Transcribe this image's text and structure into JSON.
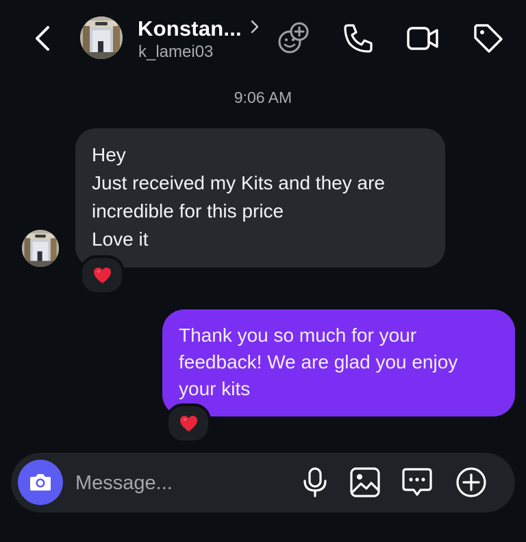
{
  "header": {
    "contact_name": "Konstan...",
    "contact_handle": "k_lamei03"
  },
  "icons": {
    "back": "chevron-left-icon",
    "profile_chevron": "chevron-right-icon",
    "add_to_group": "add-people-icon",
    "audio_call": "phone-icon",
    "video_call": "video-camera-icon",
    "label": "tag-icon",
    "camera": "camera-icon",
    "microphone": "microphone-icon",
    "gallery": "image-icon",
    "sticker": "chat-bubble-icon",
    "more": "plus-circle-icon",
    "reaction": "red-heart-emoji"
  },
  "conversation": {
    "timestamp": "9:06 AM",
    "messages": [
      {
        "direction": "incoming",
        "lines": [
          "Hey",
          "Just received my Kits and they are",
          "incredible for this price",
          "Love it"
        ],
        "reaction": "❤️"
      },
      {
        "direction": "outgoing",
        "lines": [
          "Thank you so much for your",
          "feedback! We are glad you enjoy",
          "your kits"
        ],
        "reaction": "❤️"
      }
    ]
  },
  "composer": {
    "placeholder": "Message...",
    "value": ""
  },
  "colors": {
    "background": "#0b0e12",
    "incoming_bubble": "#26292e",
    "outgoing_bubble": "#7b2ff2",
    "camera_button": "#5a5cf2",
    "secondary_text": "#a9adb3",
    "heart": "#e8253a"
  }
}
